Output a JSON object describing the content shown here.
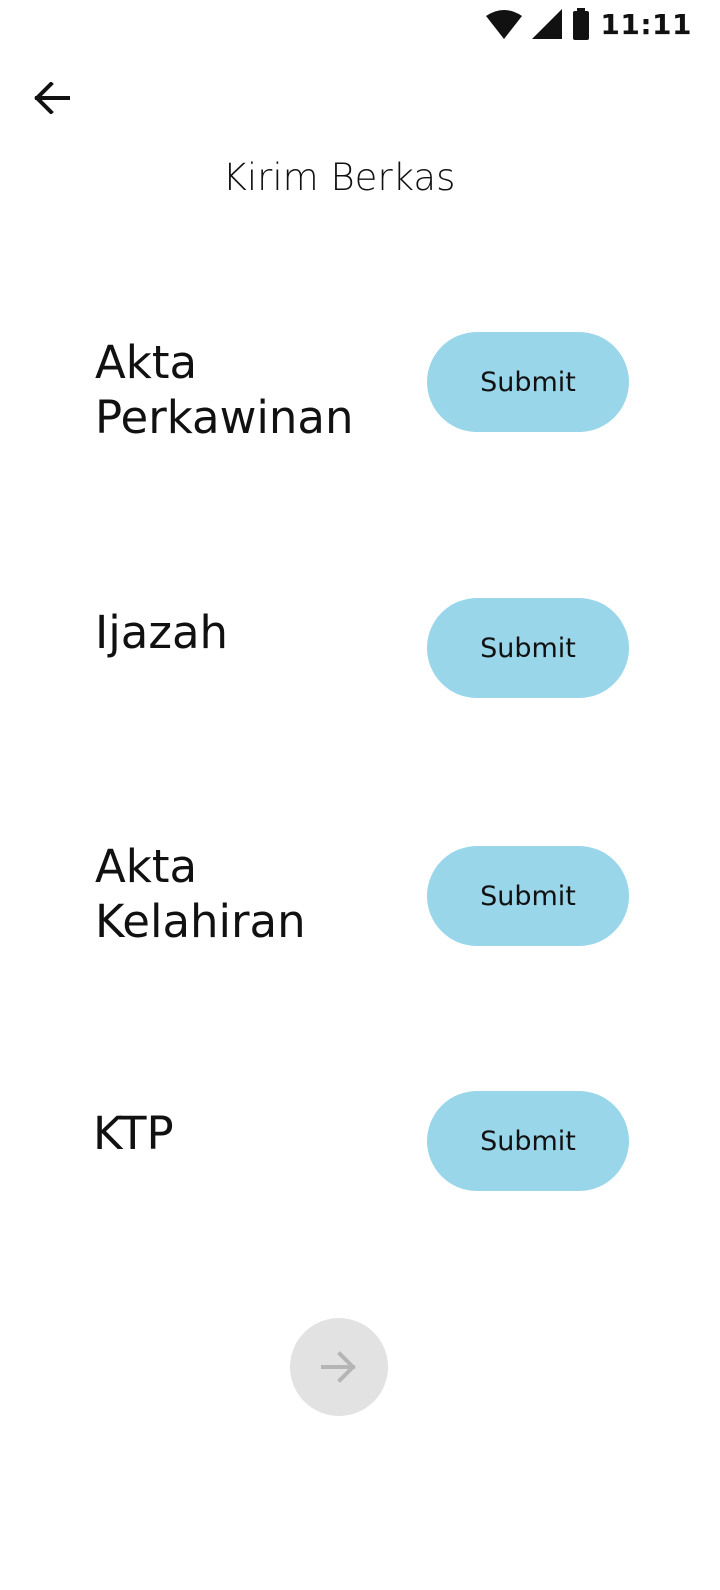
{
  "status_bar": {
    "time": "11:11",
    "icons": [
      "wifi-icon",
      "cellular-signal-icon",
      "battery-icon"
    ]
  },
  "header": {
    "back_icon": "arrow-left-icon",
    "title": "Kirim Berkas"
  },
  "documents": [
    {
      "label": "Akta Perkawinan",
      "button_label": "Submit"
    },
    {
      "label": "Ijazah",
      "button_label": "Submit"
    },
    {
      "label": "Akta Kelahiran",
      "button_label": "Submit"
    },
    {
      "label": "KTP",
      "button_label": "Submit"
    }
  ],
  "footer": {
    "next_icon": "arrow-right-icon",
    "next_enabled": false
  },
  "colors": {
    "submit_button": "#99d6ea",
    "next_button_disabled": "#e2e2e2",
    "next_icon_disabled": "#b5b5b5",
    "text": "#111111",
    "background": "#ffffff"
  }
}
